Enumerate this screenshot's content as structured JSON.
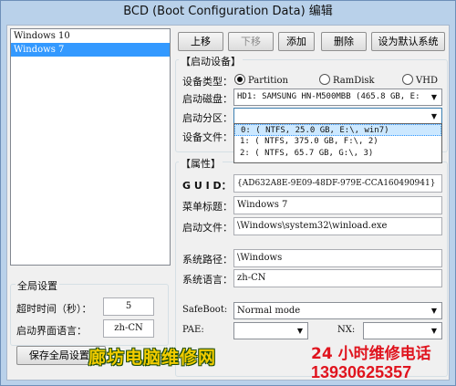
{
  "window": {
    "title": "BCD (Boot Configuration Data) 编辑"
  },
  "entries": [
    "Windows 10",
    "Windows 7"
  ],
  "toolbar": {
    "move_up": "上移",
    "move_down": "下移",
    "add": "添加",
    "delete": "删除",
    "set_default": "设为默认系统"
  },
  "boot_device": {
    "group_label": "【启动设备】",
    "device_type_label": "设备类型：",
    "radio_partition": "Partition",
    "radio_ramdisk": "RamDisk",
    "radio_vhd": "VHD",
    "boot_disk_label": "启动磁盘：",
    "boot_disk_value": "HD1: SAMSUNG HN-M500MBB (465.8 GB, E:",
    "boot_partition_label": "启动分区：",
    "device_file_label": "设备文件：",
    "partition_options": [
      "0: ( NTFS,  25.0 GB, E:\\, win7)",
      "1: ( NTFS, 375.0 GB, F:\\, 2)",
      "2: ( NTFS,  65.7 GB, G:\\, 3)"
    ]
  },
  "properties": {
    "group_label": "【属性】",
    "guid_label": "G U I D：",
    "guid_value": "{AD632A8E-9E09-48DF-979E-CCA160490941}",
    "menu_title_label": "菜单标题：",
    "menu_title_value": "Windows 7",
    "boot_file_label": "启动文件：",
    "boot_file_value": "\\Windows\\system32\\winload.exe",
    "system_path_label": "系统路径：",
    "system_path_value": "\\Windows",
    "system_lang_label": "系统语言：",
    "system_lang_value": "zh-CN",
    "safeboot_label": "SafeBoot:",
    "safeboot_value": "Normal mode",
    "pae_label": "PAE:",
    "nx_label": "NX:"
  },
  "global": {
    "group_label": "全局设置",
    "timeout_label": "超时时间（秒）：",
    "timeout_value": "5",
    "ui_lang_label": "启动界面语言：",
    "ui_lang_value": "zh-CN",
    "save_label": "保存全局设置("
  },
  "watermark": {
    "shop": "廊坊电脑维修网",
    "hotline": "24 小时维修电话",
    "phone": "13930625357"
  }
}
